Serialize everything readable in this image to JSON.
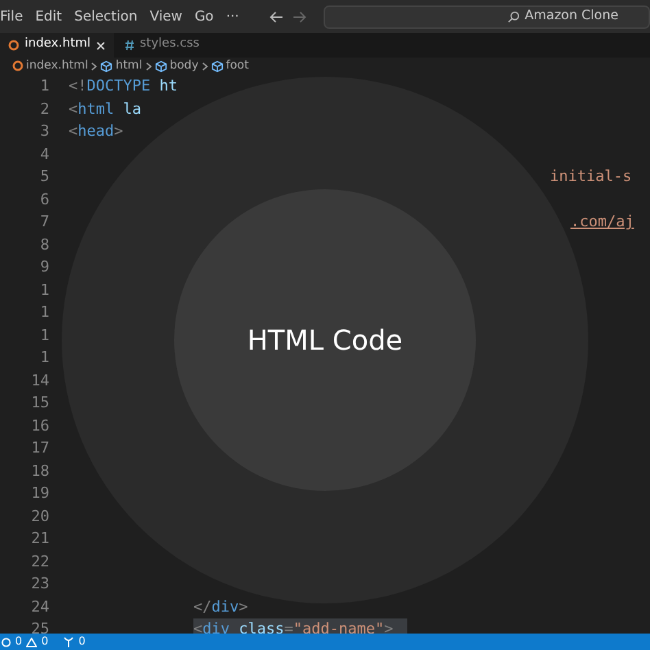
{
  "menu": [
    {
      "label": "File"
    },
    {
      "label": "Edit"
    },
    {
      "label": "Selection"
    },
    {
      "label": "View"
    },
    {
      "label": "Go"
    },
    {
      "label": "···"
    }
  ],
  "search": {
    "value": "Amazon Clone"
  },
  "tabs": [
    {
      "label": "index.html",
      "selected": true,
      "kind": "html"
    },
    {
      "label": "styles.css",
      "selected": false,
      "kind": "css"
    }
  ],
  "breadcrumbs": [
    "index.html",
    "html",
    "body",
    "foot"
  ],
  "lines": [
    {
      "number": "1",
      "highlighted": false,
      "tokens": [
        {
          "kind": "punct",
          "text": "<!"
        },
        {
          "kind": "tag",
          "text": "DOCTYPE"
        },
        {
          "kind": "attr",
          "text": " ht"
        }
      ]
    },
    {
      "number": "2",
      "highlighted": false,
      "tokens": [
        {
          "kind": "punct",
          "text": "<"
        },
        {
          "kind": "tag",
          "text": "html"
        },
        {
          "kind": "attr",
          "text": " la"
        }
      ]
    },
    {
      "number": "3",
      "highlighted": false,
      "tokens": [
        {
          "kind": "punct",
          "text": "<"
        },
        {
          "kind": "tag",
          "text": "head"
        },
        {
          "kind": "punct",
          "text": ">"
        }
      ]
    },
    {
      "number": "4"
    },
    {
      "number": "5",
      "highlighted": false,
      "tokens": [
        {
          "kind": "string",
          "text": "initial-s"
        }
      ]
    },
    {
      "number": "6"
    },
    {
      "number": "7",
      "highlighted": false,
      "tokens": [
        {
          "kind": "link",
          "text": ".com/aj"
        }
      ]
    },
    {
      "number": "8"
    },
    {
      "number": "9"
    },
    {
      "number": "1"
    },
    {
      "number": "1"
    },
    {
      "number": "1"
    },
    {
      "number": "1"
    },
    {
      "number": "14"
    },
    {
      "number": "15"
    },
    {
      "number": "16"
    },
    {
      "number": "17"
    },
    {
      "number": "18"
    },
    {
      "number": "19"
    },
    {
      "number": "20"
    },
    {
      "number": "21"
    },
    {
      "number": "22"
    },
    {
      "number": "23"
    },
    {
      "number": "24",
      "highlighted": false,
      "tokens": [
        {
          "kind": "punct",
          "text": "</"
        },
        {
          "kind": "tag",
          "text": "div"
        },
        {
          "kind": "punct",
          "text": ">"
        }
      ]
    },
    {
      "number": "25",
      "highlighted": true,
      "tokens": [
        {
          "kind": "punct",
          "text": "<"
        },
        {
          "kind": "tag",
          "text": "div"
        },
        {
          "kind": "attr",
          "text": " class"
        },
        {
          "kind": "punct",
          "text": "="
        },
        {
          "kind": "string",
          "text": "\"add-name\""
        },
        {
          "kind": "punct",
          "text": ">"
        }
      ]
    }
  ],
  "overlay": {
    "title": "HTML Code"
  },
  "status": {
    "errors": "0",
    "warnings": "0",
    "ports": "0"
  }
}
